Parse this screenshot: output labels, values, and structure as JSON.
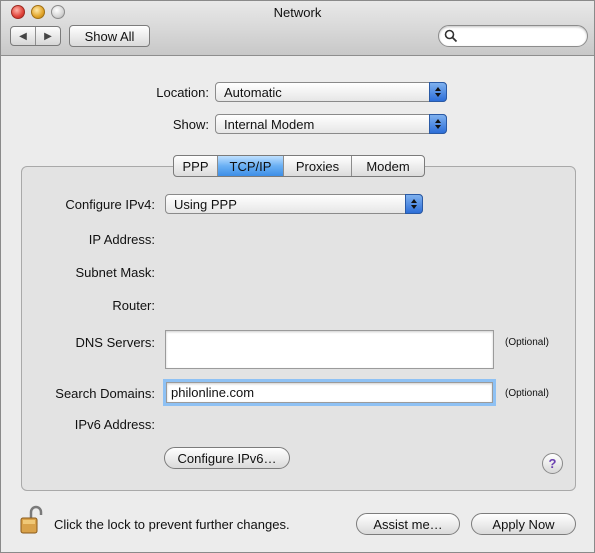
{
  "window": {
    "title": "Network"
  },
  "toolbar": {
    "back_icon": "back-arrow-icon",
    "forward_icon": "forward-arrow-icon",
    "show_all_label": "Show All",
    "search_placeholder": "",
    "search_icon": "search-icon"
  },
  "location": {
    "label": "Location:",
    "value": "Automatic"
  },
  "show": {
    "label": "Show:",
    "value": "Internal Modem"
  },
  "tabs": [
    {
      "label": "PPP",
      "selected": false
    },
    {
      "label": "TCP/IP",
      "selected": true
    },
    {
      "label": "Proxies",
      "selected": false
    },
    {
      "label": "Modem",
      "selected": false
    }
  ],
  "tcpip": {
    "configure_ipv4": {
      "label": "Configure IPv4:",
      "value": "Using PPP"
    },
    "ip_address_label": "IP Address:",
    "subnet_mask_label": "Subnet Mask:",
    "router_label": "Router:",
    "dns_servers": {
      "label": "DNS Servers:",
      "value": "",
      "hint": "(Optional)"
    },
    "search_domains": {
      "label": "Search Domains:",
      "value": "philonline.com",
      "hint": "(Optional)"
    },
    "ipv6_address_label": "IPv6 Address:",
    "configure_ipv6_button": "Configure IPv6…",
    "help_icon": "help-icon",
    "help_label": "?"
  },
  "footer": {
    "lock_icon": "padlock-open-icon",
    "lock_text": "Click the lock to prevent further changes.",
    "assist_button": "Assist me…",
    "apply_button": "Apply Now"
  },
  "colors": {
    "accent": "#3e8ee6",
    "focus_ring": "#8ec1f4",
    "help_mark": "#6a3fb0"
  }
}
